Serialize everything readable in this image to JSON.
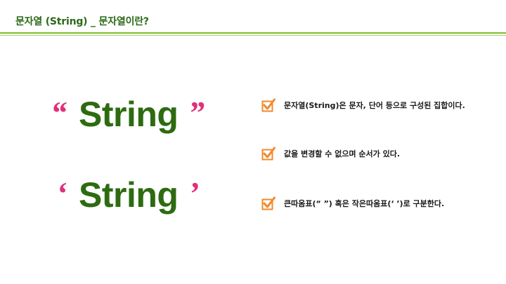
{
  "slide": {
    "title": "문자열 (String) _ 문자열이란?"
  },
  "examples": [
    {
      "open_quote": "“",
      "word": "String",
      "close_quote": "”"
    },
    {
      "open_quote": "‘",
      "word": "String",
      "close_quote": "’"
    }
  ],
  "bullets": [
    {
      "text": "문자열(String)은 문자, 단어 등으로 구성된 집합이다."
    },
    {
      "text": "값을 변경할 수 없으며 순서가 있다."
    },
    {
      "text": "큰따옴표(“ ”) 혹은 작은따옴표(‘ ’)로 구분한다."
    }
  ],
  "colors": {
    "title": "#2b6a16",
    "accent_line": "#7bbf2a",
    "word": "#2d6b10",
    "quote": "#e0307a",
    "checkbox": "#f08a2c"
  },
  "icons": {
    "bullet": "checked-box-icon"
  }
}
